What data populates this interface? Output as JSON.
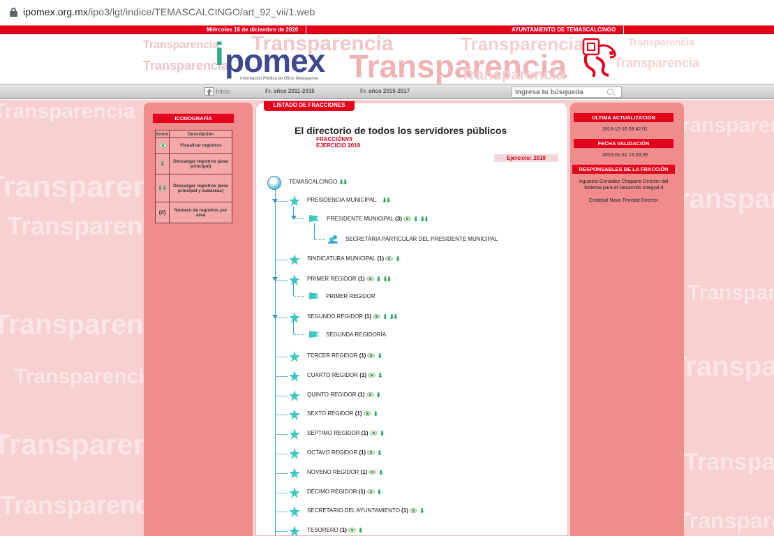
{
  "browser": {
    "url_host": "ipomex.org.mx",
    "url_path": "/ipo3/lgt/indice/TEMASCALCINGO/art_92_vii/1.web"
  },
  "topbar": {
    "date": "Miércoles 16 de diciembre de 2020",
    "ayuntamiento": "AYUNTAMIENTO DE TEMASCALCINGO"
  },
  "header": {
    "logo_word": "pomex",
    "logo_sub": "Información Pública de Oficio Mexiquense",
    "watermark_word": "Transparencia"
  },
  "nav": {
    "home_label": "Inicio",
    "link1": "Fr. años 2011-2015",
    "link2": "Fr. años 2015-2017",
    "search_placeholder": "Ingresa tu búsqueda"
  },
  "left": {
    "title": "ICONOGRAFÍA",
    "col_icon": "Icono",
    "col_desc": "Descripción",
    "rows": [
      {
        "icon": "view-icon",
        "desc": "Visualizar registros"
      },
      {
        "icon": "download-icon",
        "desc": "Descargar registros (área principal)"
      },
      {
        "icon": "download-all-icon",
        "desc": "Descargar registros (área principal y subáreas)"
      },
      {
        "icon": "#",
        "symbol": "(#)",
        "desc": "Número de registros por área"
      }
    ]
  },
  "right": {
    "ultima_title": "ULTIMA ACTUALIZACIÓN",
    "ultima_value": "2019-12-16 09:42:01",
    "validacion_title": "FECHA VALIDACIÓN",
    "validacion_value": "2020-01-31 15:33:39",
    "responsables_title": "RESPONSABLES DE LA FRACCIÓN",
    "responsable1": "Agustina Gonzalez Chaparro Director del Sistema para el Desarrollo Integral d",
    "responsable2": "Cristobal Nava Trinidad Director"
  },
  "center": {
    "tab_title": "LISTADO DE FRACCIONES",
    "title": "El directorio de todos los servidores públicos",
    "fraccion": "FRACCIÓNVII",
    "ejercicio": "EJERCICIO 2019",
    "ejercicio_badge": "Ejercicio: 2019"
  },
  "tree": {
    "root": "TEMASCALCINGO",
    "presidencia": "PRESIDENCIA MUNICIPAL.",
    "presidente": "PRESIDENTE MUNICIPAL",
    "presidente_count": "(3)",
    "secretaria_particular": "SECRETARIA PARTICULAR DEL PRESIDENTE MUNICIPAL",
    "items": [
      {
        "label": "SINDICATURA MUNICIPAL",
        "count": "(1)"
      },
      {
        "label": "PRIMER REGIDOR",
        "count": "(1)"
      },
      {
        "label": "SEGUNDO REGIDOR",
        "count": "(1)"
      },
      {
        "label": "TERCER REGIDOR",
        "count": "(1)"
      },
      {
        "label": "CUARTO REGIDOR",
        "count": "(1)"
      },
      {
        "label": "QUINTO REGIDOR",
        "count": "(1)"
      },
      {
        "label": "SEXTO REGIDOR",
        "count": "(1)"
      },
      {
        "label": "SEPTIMO REGIDOR",
        "count": "(1)"
      },
      {
        "label": "OCTAVO REGIDOR",
        "count": "(1)"
      },
      {
        "label": "NOVENO REGIDOR",
        "count": "(1)"
      },
      {
        "label": "DÉCIMO REGIDOR",
        "count": "(1)"
      },
      {
        "label": "SECRETARIO DEL AYUNTAMIENTO",
        "count": "(1)"
      },
      {
        "label": "TESORERO",
        "count": "(1)"
      }
    ],
    "primer_child": "PRIMER REGIDOR",
    "segundo_child": "SEGUNDA REGIDORÍA"
  },
  "colors": {
    "brand_red": "#e3001b",
    "tree_teal": "#3aa6c9",
    "star_teal": "#3cc9c0",
    "panel_pink": "#f08c8c"
  }
}
